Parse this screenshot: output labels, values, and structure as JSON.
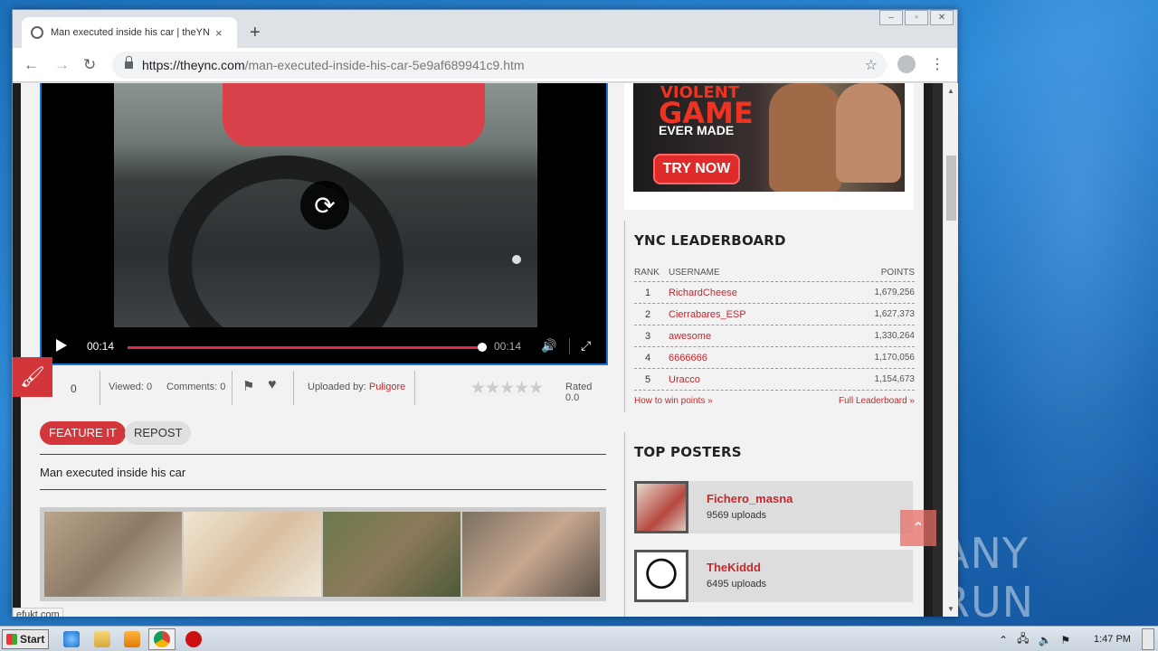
{
  "browser": {
    "tab_title": "Man executed inside his car | theYNC",
    "tab_close": "×",
    "new_tab": "+",
    "url_host": "https://theync.com",
    "url_path": "/man-executed-inside-his-car-5e9af689941c9.htm",
    "back": "←",
    "forward": "→",
    "reload": "↻",
    "star": "☆",
    "menu": "⋮",
    "window_min": "‒",
    "window_max": "▫",
    "window_close": "✕"
  },
  "video": {
    "current_time": "00:14",
    "duration": "00:14",
    "progress": 1.0
  },
  "stats": {
    "likes": "0",
    "viewed": "Viewed: 0",
    "comments": "Comments: 0",
    "uploaded_by_label": "Uploaded by: ",
    "uploader": "Puligore",
    "stars": "★★★★★",
    "rated": "Rated 0.0"
  },
  "actions": {
    "feature": "FEATURE IT",
    "repost": "REPOST"
  },
  "description": "Man executed inside his car",
  "status_link": "efukt.com",
  "ad": {
    "line1": "VIOLENT",
    "line2": "GAME",
    "line3": "EVER MADE",
    "cta": "TRY NOW"
  },
  "leaderboard": {
    "title": "YNC LEADERBOARD",
    "col_rank": "RANK",
    "col_user": "USERNAME",
    "col_points": "POINTS",
    "rows": [
      {
        "rank": "1",
        "user": "RichardCheese",
        "points": "1,679,256"
      },
      {
        "rank": "2",
        "user": "Cierrabares_ESP",
        "points": "1,627,373"
      },
      {
        "rank": "3",
        "user": "awesome",
        "points": "1,330,264"
      },
      {
        "rank": "4",
        "user": "6666666",
        "points": "1,170,056"
      },
      {
        "rank": "5",
        "user": "Uracco",
        "points": "1,154,673"
      }
    ],
    "how_to": "How to win points »",
    "full": "Full Leaderboard »"
  },
  "top_posters": {
    "title": "TOP POSTERS",
    "items": [
      {
        "name": "Fichero_masna",
        "uploads": "9569 uploads"
      },
      {
        "name": "TheKiddd",
        "uploads": "6495 uploads"
      }
    ]
  },
  "watermark": "ANY RUN",
  "taskbar": {
    "start": "Start",
    "clock": "1:47 PM"
  },
  "colors": {
    "accent": "#d3373c",
    "link": "#c3282d",
    "progress": "#e0294a"
  }
}
